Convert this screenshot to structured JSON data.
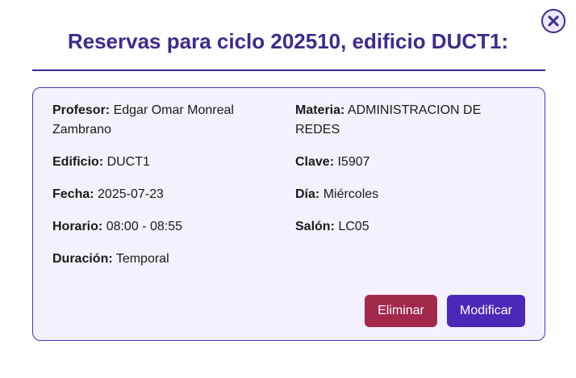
{
  "modal": {
    "title": "Reservas para ciclo 202510, edificio DUCT1:",
    "close_icon": "close-x-icon"
  },
  "reservation": {
    "profesor": {
      "label": "Profesor:",
      "value": "Edgar Omar Monreal Zambrano"
    },
    "materia": {
      "label": "Materia:",
      "value": "ADMINISTRACION DE REDES"
    },
    "edificio": {
      "label": "Edificio:",
      "value": "DUCT1"
    },
    "clave": {
      "label": "Clave:",
      "value": "I5907"
    },
    "fecha": {
      "label": "Fecha:",
      "value": "2025-07-23"
    },
    "dia": {
      "label": "Día:",
      "value": "Miércoles"
    },
    "horario": {
      "label": "Horario:",
      "value": "08:00 - 08:55"
    },
    "salon": {
      "label": "Salón:",
      "value": "LC05"
    },
    "duracion": {
      "label": "Duración:",
      "value": "Temporal"
    }
  },
  "actions": {
    "delete_label": "Eliminar",
    "modify_label": "Modificar"
  },
  "colors": {
    "accent": "#3f2a8c",
    "card_bg": "#f3f1fe",
    "delete": "#a3294b",
    "modify": "#4a29b8"
  }
}
